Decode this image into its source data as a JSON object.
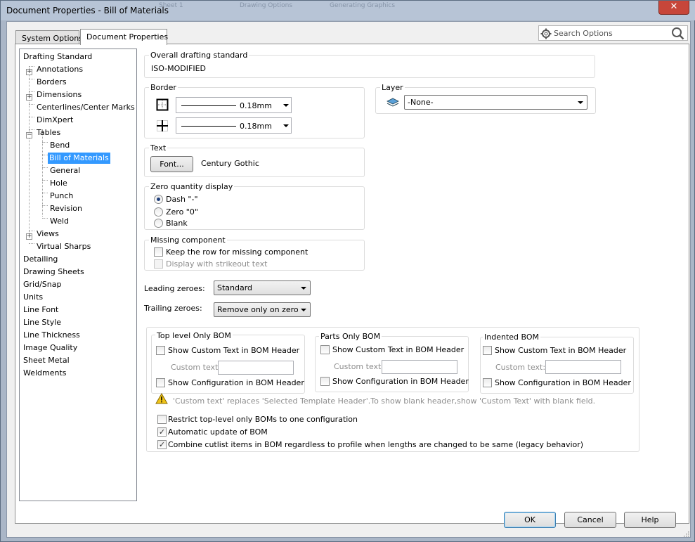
{
  "window": {
    "title": "Document Properties - Bill of Materials",
    "close_icon": "close-icon",
    "ghost_texts": [
      "Sheet 1",
      "Drawing Options",
      "Generating Graphics"
    ]
  },
  "tabs": [
    {
      "label": "System Options"
    },
    {
      "label": "Document Properties"
    }
  ],
  "search": {
    "placeholder": "Search Options"
  },
  "tree": [
    {
      "label": "Drafting Standard"
    },
    {
      "label": "Annotations"
    },
    {
      "label": "Borders"
    },
    {
      "label": "Dimensions"
    },
    {
      "label": "Centerlines/Center Marks"
    },
    {
      "label": "DimXpert"
    },
    {
      "label": "Tables"
    },
    {
      "label": "Bend"
    },
    {
      "label": "Bill of Materials"
    },
    {
      "label": "General"
    },
    {
      "label": "Hole"
    },
    {
      "label": "Punch"
    },
    {
      "label": "Revision"
    },
    {
      "label": "Weld"
    },
    {
      "label": "Views"
    },
    {
      "label": "Virtual Sharps"
    },
    {
      "label": "Detailing"
    },
    {
      "label": "Drawing Sheets"
    },
    {
      "label": "Grid/Snap"
    },
    {
      "label": "Units"
    },
    {
      "label": "Line Font"
    },
    {
      "label": "Line Style"
    },
    {
      "label": "Line Thickness"
    },
    {
      "label": "Image Quality"
    },
    {
      "label": "Sheet Metal"
    },
    {
      "label": "Weldments"
    }
  ],
  "overall": {
    "label": "Overall drafting standard",
    "value": "ISO-MODIFIED"
  },
  "border": {
    "label": "Border",
    "outer_thickness": "0.18mm",
    "inner_thickness": "0.18mm"
  },
  "layer": {
    "label": "Layer",
    "value": "-None-"
  },
  "text": {
    "label": "Text",
    "font_button": "Font...",
    "font_name": "Century Gothic"
  },
  "zero_qty": {
    "label": "Zero quantity display",
    "options": [
      "Dash \"-\"",
      "Zero \"0\"",
      "Blank"
    ],
    "selected": "Dash \"-\""
  },
  "missing": {
    "label": "Missing component",
    "keep_row": "Keep the row for missing component",
    "strikeout": "Display with strikeout text"
  },
  "leading": {
    "label": "Leading zeroes:",
    "value": "Standard"
  },
  "trailing": {
    "label": "Trailing zeroes:",
    "value": "Remove only on zero"
  },
  "bom_groups": [
    {
      "title": "Top level Only BOM",
      "custom_header": "Show Custom Text in BOM Header",
      "custom_text_label": "Custom text:",
      "show_config": "Show Configuration in BOM Header"
    },
    {
      "title": "Parts Only BOM",
      "custom_header": "Show Custom Text in BOM Header",
      "custom_text_label": "Custom text:",
      "show_config": "Show Configuration in BOM Header"
    },
    {
      "title": "Indented BOM",
      "custom_header": "Show Custom Text in BOM Header",
      "custom_text_label": "Custom text:",
      "show_config": "Show Configuration in BOM Header"
    }
  ],
  "warning": "'Custom text' replaces 'Selected Template Header'.To show blank header,show 'Custom Text' with blank field.",
  "options": {
    "restrict": {
      "label": "Restrict top-level only BOMs to one configuration",
      "checked": false
    },
    "auto_update": {
      "label": "Automatic update of BOM",
      "checked": true
    },
    "combine": {
      "label": "Combine cutlist items in BOM regardless to profile when lengths are changed to be same (legacy behavior)",
      "checked": true
    }
  },
  "footer": {
    "ok": "OK",
    "cancel": "Cancel",
    "help": "Help"
  },
  "colors": {
    "selection": "#3399ff",
    "close": "#c7463a",
    "warning": "#f0c419"
  }
}
